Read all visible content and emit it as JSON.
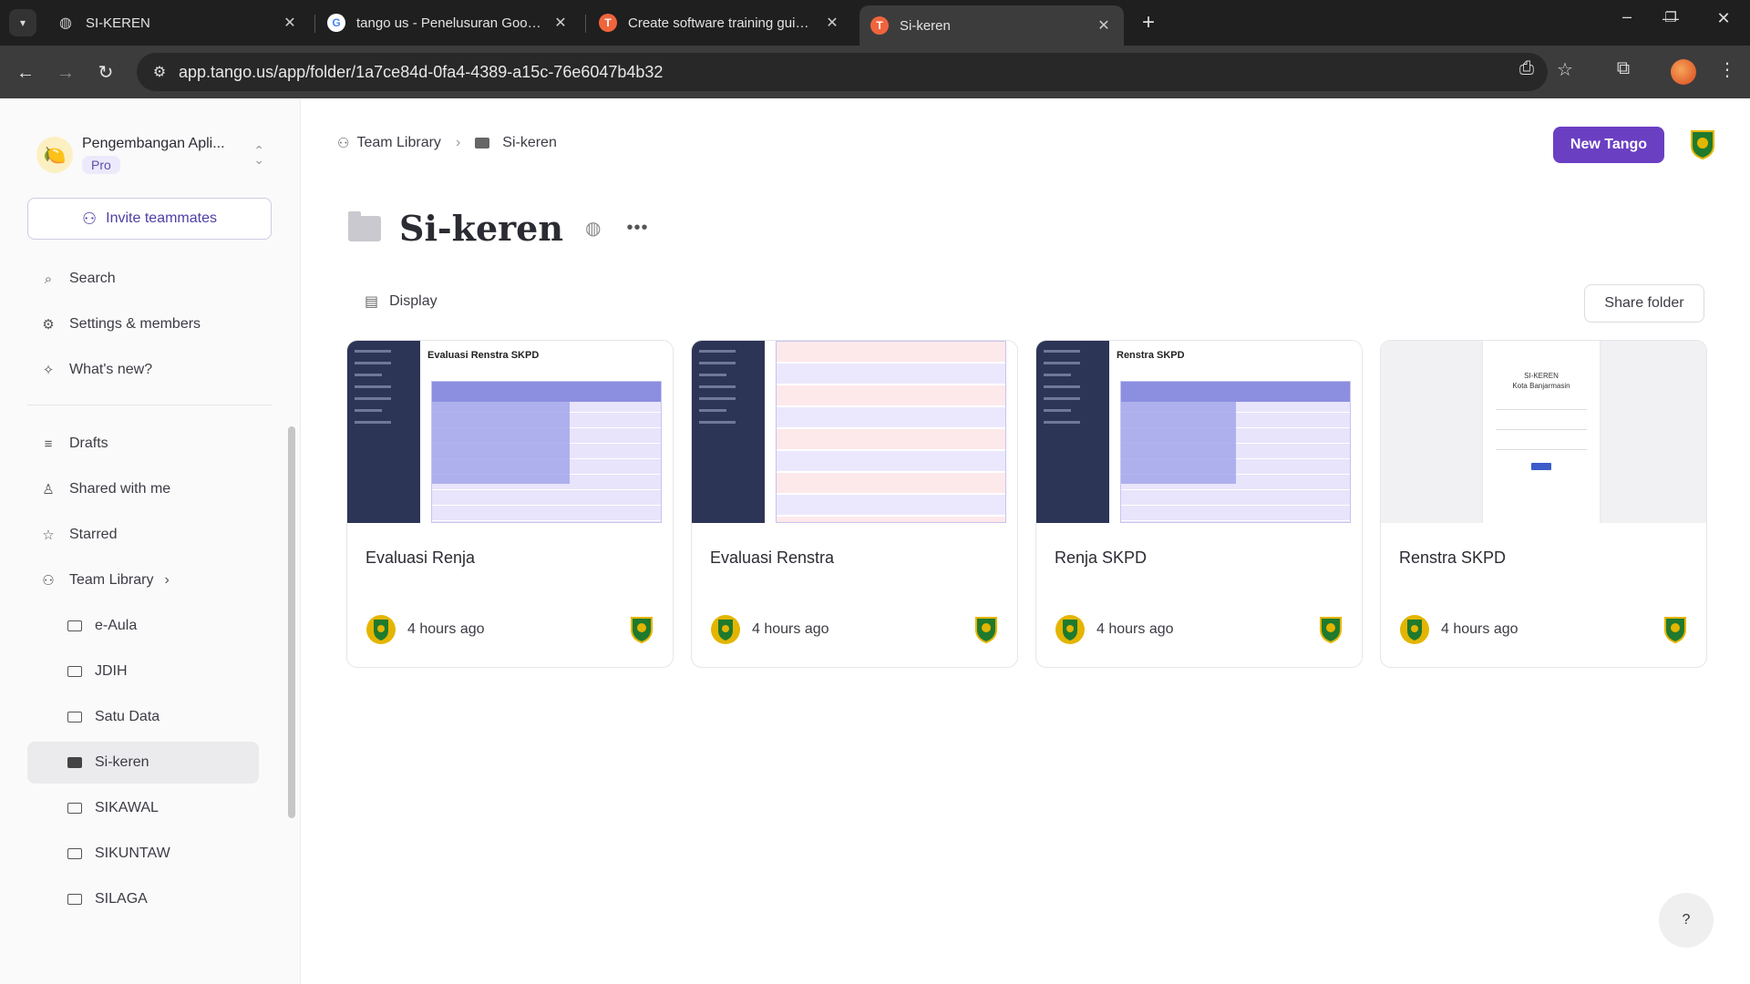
{
  "browser": {
    "tabs": [
      {
        "title": "SI-KEREN",
        "favicon": "globe-icon"
      },
      {
        "title": "tango us - Penelusuran Google",
        "favicon": "google-icon"
      },
      {
        "title": "Create software training guides",
        "favicon": "tango-icon"
      },
      {
        "title": "Si-keren",
        "favicon": "tango-icon"
      }
    ],
    "url": "app.tango.us/app/folder/1a7ce84d-0fa4-4389-a15c-76e6047b4b32"
  },
  "sidebar": {
    "workspace_name": "Pengembangan Apli...",
    "plan": "Pro",
    "invite_label": "Invite teammates",
    "top_items": [
      {
        "label": "Search",
        "icon": "search-icon"
      },
      {
        "label": "Settings & members",
        "icon": "gear-icon"
      },
      {
        "label": "What's new?",
        "icon": "sparkle-icon"
      }
    ],
    "items": [
      {
        "label": "Drafts",
        "icon": "drafts-icon"
      },
      {
        "label": "Shared with me",
        "icon": "person-icon"
      },
      {
        "label": "Starred",
        "icon": "star-icon"
      },
      {
        "label": "Team Library",
        "icon": "team-icon"
      }
    ],
    "folders": [
      "e-Aula",
      "JDIH",
      "Satu Data",
      "Si-keren",
      "SIKAWAL",
      "SIKUNTAW",
      "SILAGA"
    ],
    "active_folder": "Si-keren"
  },
  "breadcrumb": {
    "root": "Team Library",
    "current": "Si-keren"
  },
  "header": {
    "new_button": "New Tango"
  },
  "page": {
    "title": "Si-keren",
    "display_label": "Display",
    "share_label": "Share folder"
  },
  "cards": [
    {
      "title": "Evaluasi Renja",
      "time": "4 hours ago",
      "thumb_title": "Evaluasi Renstra SKPD"
    },
    {
      "title": "Evaluasi Renstra",
      "time": "4 hours ago",
      "thumb_title": ""
    },
    {
      "title": "Renja SKPD",
      "time": "4 hours ago",
      "thumb_title": "Renstra SKPD"
    },
    {
      "title": "Renstra SKPD",
      "time": "4 hours ago",
      "thumb_title": "SI-KEREN",
      "thumb_subtitle": "Kota Banjarmasin"
    }
  ],
  "help_label": "?",
  "colors": {
    "accent": "#6a3fc2",
    "thumb_nav": "#2c3556",
    "table_blue": "#8c8fe0"
  }
}
